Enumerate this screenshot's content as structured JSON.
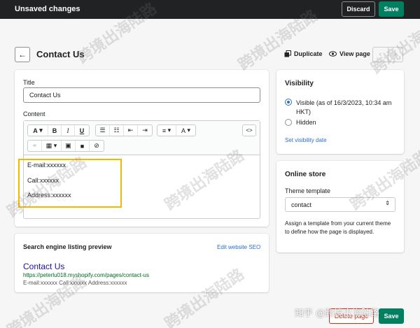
{
  "topbar": {
    "status": "Unsaved changes",
    "discard_label": "Discard",
    "save_label": "Save"
  },
  "header": {
    "title": "Contact Us",
    "duplicate_label": "Duplicate",
    "view_page_label": "View page"
  },
  "main": {
    "title_label": "Title",
    "title_value": "Contact Us",
    "content_label": "Content",
    "toolbar": {
      "font_button": "A",
      "bold": "B",
      "italic": "I",
      "underline": "U",
      "align_button": "≡",
      "color_button": "A",
      "html_button": "<>"
    },
    "content_lines": [
      "E-mail:xxxxxx",
      "Call:xxxxxx",
      "Address:xxxxxx"
    ],
    "highlight_color": "#f5b800"
  },
  "seo": {
    "heading": "Search engine listing preview",
    "edit_link": "Edit website SEO",
    "preview_title": "Contact Us",
    "preview_url": "https://peterlu018.myshopify.com/pages/contact-us",
    "preview_description": "E-mail:xxxxxx Call:xxxxxx Address:xxxxxx"
  },
  "visibility": {
    "heading": "Visibility",
    "options": [
      {
        "label": "Visible (as of 16/3/2023, 10:34 am HKT)",
        "selected": true
      },
      {
        "label": "Hidden",
        "selected": false
      }
    ],
    "set_date_link": "Set visibility date"
  },
  "online_store": {
    "heading": "Online store",
    "template_label": "Theme template",
    "template_value": "contact",
    "help_text": "Assign a template from your current theme to define how the page is displayed."
  },
  "footer": {
    "delete_label": "Delete page",
    "save_label": "Save"
  },
  "watermark": {
    "text": "跨境出海陆路",
    "credit": "知乎 @跨境出海陆路"
  },
  "colors": {
    "accent": "#008060",
    "link": "#2c6ecb",
    "topbar": "#202223",
    "danger": "#d82c0d"
  }
}
